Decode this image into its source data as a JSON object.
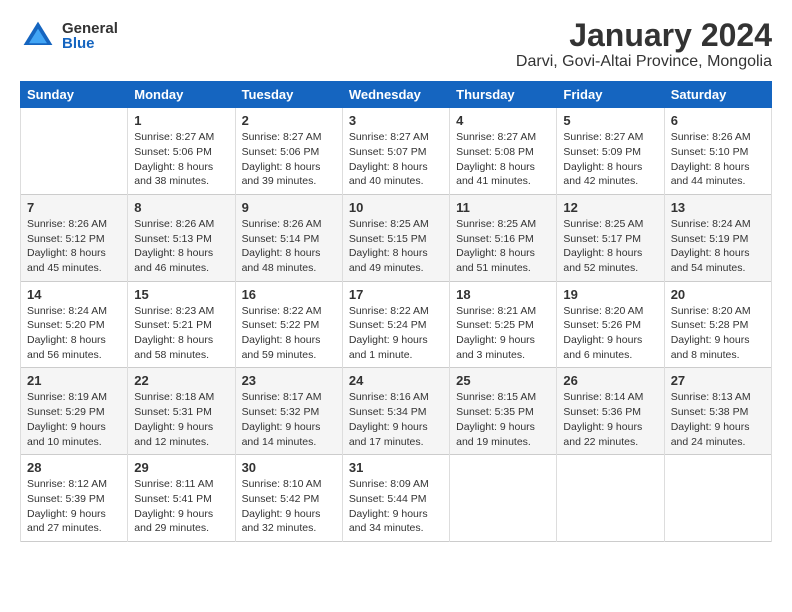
{
  "logo": {
    "general": "General",
    "blue": "Blue"
  },
  "title": "January 2024",
  "location": "Darvi, Govi-Altai Province, Mongolia",
  "days_of_week": [
    "Sunday",
    "Monday",
    "Tuesday",
    "Wednesday",
    "Thursday",
    "Friday",
    "Saturday"
  ],
  "weeks": [
    [
      {
        "day": "",
        "info": ""
      },
      {
        "day": "1",
        "info": "Sunrise: 8:27 AM\nSunset: 5:06 PM\nDaylight: 8 hours\nand 38 minutes."
      },
      {
        "day": "2",
        "info": "Sunrise: 8:27 AM\nSunset: 5:06 PM\nDaylight: 8 hours\nand 39 minutes."
      },
      {
        "day": "3",
        "info": "Sunrise: 8:27 AM\nSunset: 5:07 PM\nDaylight: 8 hours\nand 40 minutes."
      },
      {
        "day": "4",
        "info": "Sunrise: 8:27 AM\nSunset: 5:08 PM\nDaylight: 8 hours\nand 41 minutes."
      },
      {
        "day": "5",
        "info": "Sunrise: 8:27 AM\nSunset: 5:09 PM\nDaylight: 8 hours\nand 42 minutes."
      },
      {
        "day": "6",
        "info": "Sunrise: 8:26 AM\nSunset: 5:10 PM\nDaylight: 8 hours\nand 44 minutes."
      }
    ],
    [
      {
        "day": "7",
        "info": "Sunrise: 8:26 AM\nSunset: 5:12 PM\nDaylight: 8 hours\nand 45 minutes."
      },
      {
        "day": "8",
        "info": "Sunrise: 8:26 AM\nSunset: 5:13 PM\nDaylight: 8 hours\nand 46 minutes."
      },
      {
        "day": "9",
        "info": "Sunrise: 8:26 AM\nSunset: 5:14 PM\nDaylight: 8 hours\nand 48 minutes."
      },
      {
        "day": "10",
        "info": "Sunrise: 8:25 AM\nSunset: 5:15 PM\nDaylight: 8 hours\nand 49 minutes."
      },
      {
        "day": "11",
        "info": "Sunrise: 8:25 AM\nSunset: 5:16 PM\nDaylight: 8 hours\nand 51 minutes."
      },
      {
        "day": "12",
        "info": "Sunrise: 8:25 AM\nSunset: 5:17 PM\nDaylight: 8 hours\nand 52 minutes."
      },
      {
        "day": "13",
        "info": "Sunrise: 8:24 AM\nSunset: 5:19 PM\nDaylight: 8 hours\nand 54 minutes."
      }
    ],
    [
      {
        "day": "14",
        "info": "Sunrise: 8:24 AM\nSunset: 5:20 PM\nDaylight: 8 hours\nand 56 minutes."
      },
      {
        "day": "15",
        "info": "Sunrise: 8:23 AM\nSunset: 5:21 PM\nDaylight: 8 hours\nand 58 minutes."
      },
      {
        "day": "16",
        "info": "Sunrise: 8:22 AM\nSunset: 5:22 PM\nDaylight: 8 hours\nand 59 minutes."
      },
      {
        "day": "17",
        "info": "Sunrise: 8:22 AM\nSunset: 5:24 PM\nDaylight: 9 hours\nand 1 minute."
      },
      {
        "day": "18",
        "info": "Sunrise: 8:21 AM\nSunset: 5:25 PM\nDaylight: 9 hours\nand 3 minutes."
      },
      {
        "day": "19",
        "info": "Sunrise: 8:20 AM\nSunset: 5:26 PM\nDaylight: 9 hours\nand 6 minutes."
      },
      {
        "day": "20",
        "info": "Sunrise: 8:20 AM\nSunset: 5:28 PM\nDaylight: 9 hours\nand 8 minutes."
      }
    ],
    [
      {
        "day": "21",
        "info": "Sunrise: 8:19 AM\nSunset: 5:29 PM\nDaylight: 9 hours\nand 10 minutes."
      },
      {
        "day": "22",
        "info": "Sunrise: 8:18 AM\nSunset: 5:31 PM\nDaylight: 9 hours\nand 12 minutes."
      },
      {
        "day": "23",
        "info": "Sunrise: 8:17 AM\nSunset: 5:32 PM\nDaylight: 9 hours\nand 14 minutes."
      },
      {
        "day": "24",
        "info": "Sunrise: 8:16 AM\nSunset: 5:34 PM\nDaylight: 9 hours\nand 17 minutes."
      },
      {
        "day": "25",
        "info": "Sunrise: 8:15 AM\nSunset: 5:35 PM\nDaylight: 9 hours\nand 19 minutes."
      },
      {
        "day": "26",
        "info": "Sunrise: 8:14 AM\nSunset: 5:36 PM\nDaylight: 9 hours\nand 22 minutes."
      },
      {
        "day": "27",
        "info": "Sunrise: 8:13 AM\nSunset: 5:38 PM\nDaylight: 9 hours\nand 24 minutes."
      }
    ],
    [
      {
        "day": "28",
        "info": "Sunrise: 8:12 AM\nSunset: 5:39 PM\nDaylight: 9 hours\nand 27 minutes."
      },
      {
        "day": "29",
        "info": "Sunrise: 8:11 AM\nSunset: 5:41 PM\nDaylight: 9 hours\nand 29 minutes."
      },
      {
        "day": "30",
        "info": "Sunrise: 8:10 AM\nSunset: 5:42 PM\nDaylight: 9 hours\nand 32 minutes."
      },
      {
        "day": "31",
        "info": "Sunrise: 8:09 AM\nSunset: 5:44 PM\nDaylight: 9 hours\nand 34 minutes."
      },
      {
        "day": "",
        "info": ""
      },
      {
        "day": "",
        "info": ""
      },
      {
        "day": "",
        "info": ""
      }
    ]
  ]
}
